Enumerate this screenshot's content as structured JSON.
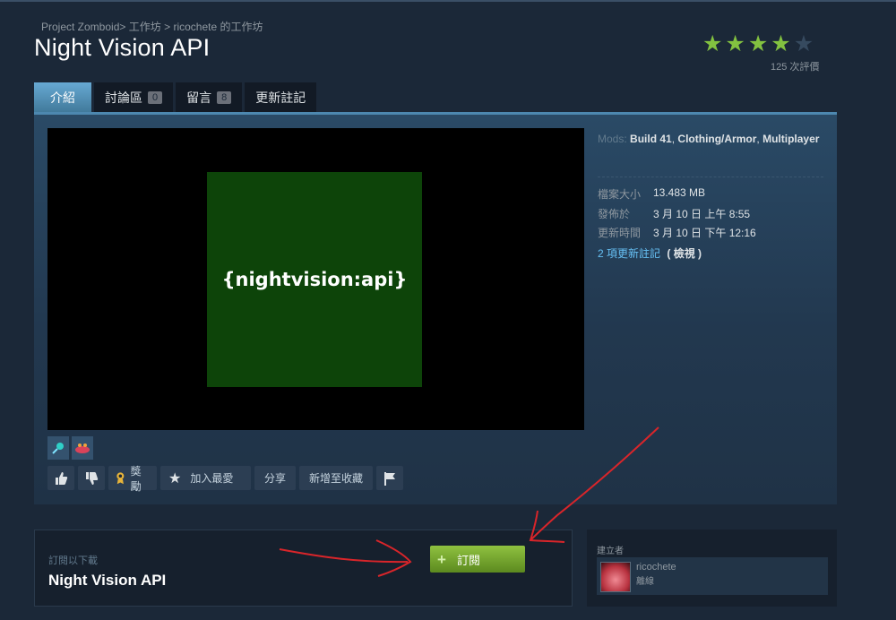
{
  "breadcrumb": {
    "game": "Project Zomboid",
    "sep1": ">",
    "workshop": "工作坊",
    "sep2": ">",
    "author_workshop": "ricochete 的工作坊"
  },
  "title": "Night Vision API",
  "rating": {
    "stars": 4,
    "max": 5,
    "count_text": "125 次評價"
  },
  "tabs": [
    {
      "label": "介紹",
      "active": true
    },
    {
      "label": "討論區",
      "count": "0"
    },
    {
      "label": "留言",
      "count": "8"
    },
    {
      "label": "更新註記"
    }
  ],
  "preview": {
    "text": "{nightvision:api}"
  },
  "actions": {
    "award": "獎勵",
    "favorite": "加入最愛",
    "share": "分享",
    "add_collection": "新增至收藏"
  },
  "meta": {
    "tags_label": "Mods:",
    "tag1": "Build 41",
    "comma1": ",",
    "tag2": "Clothing/Armor",
    "comma2": ",",
    "tag3": "Multiplayer",
    "file_size_label": "檔案大小",
    "file_size": "13.483 MB",
    "posted_label": "發佈於",
    "posted": "3 月 10 日 上午 8:55",
    "updated_label": "更新時間",
    "updated": "3 月 10 日 下午 12:16",
    "changes_link": "2 項更新註記",
    "view": "( 檢視 )"
  },
  "subscribe": {
    "label": "訂閱以下載",
    "title": "Night Vision API",
    "button": "訂閱"
  },
  "creator": {
    "label": "建立者",
    "name": "ricochete",
    "status": "離線"
  },
  "colors": {
    "background": "#1b2838",
    "accent": "#66c0f4",
    "star_on": "#83c240",
    "subscribe_green": "#8fc140",
    "annotation_red": "#d9252a"
  }
}
